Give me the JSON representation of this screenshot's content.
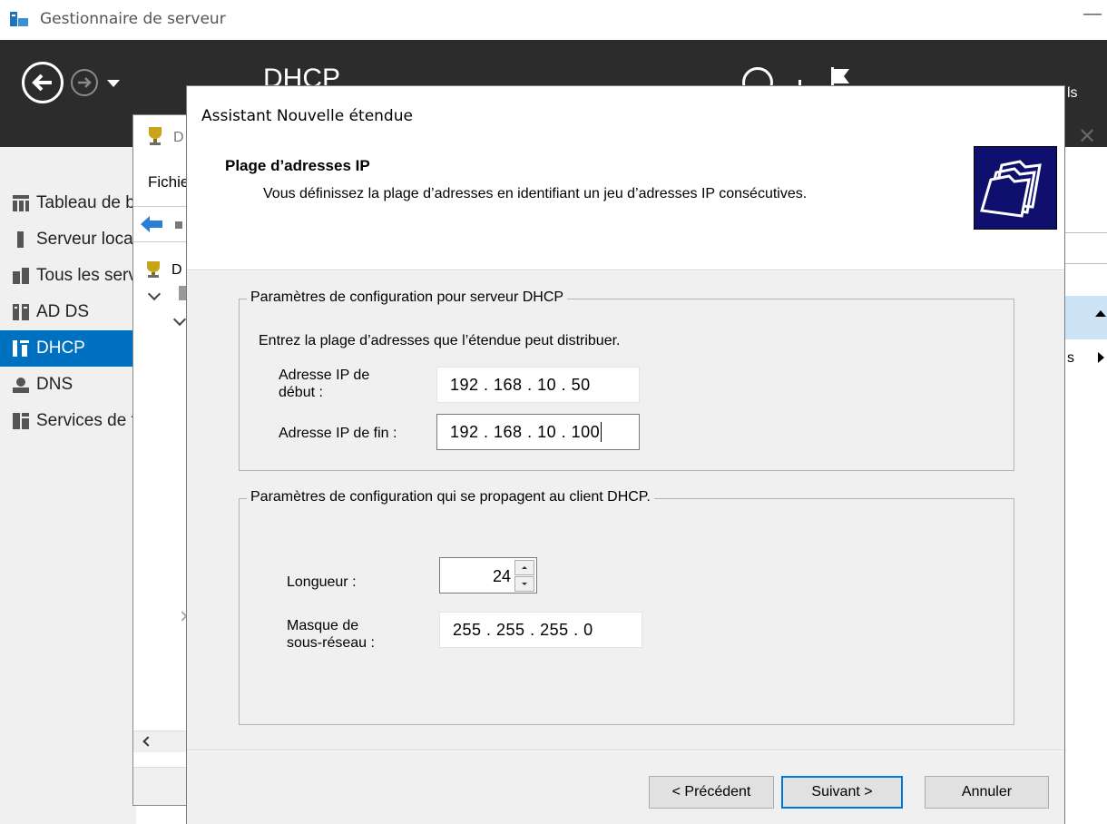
{
  "server_manager": {
    "title": "Gestionnaire de serveur",
    "breadcrumb": "DHCP",
    "tools_fragment": "ls",
    "sidebar": {
      "items": [
        {
          "label": "Tableau de bord",
          "icon": "dashboard-icon",
          "selected": false
        },
        {
          "label": "Serveur local",
          "icon": "server-icon",
          "selected": false
        },
        {
          "label": "Tous les serveurs",
          "icon": "servers-icon",
          "selected": false
        },
        {
          "label": "AD DS",
          "icon": "ad-ds-icon",
          "selected": false
        },
        {
          "label": "DHCP",
          "icon": "dhcp-icon",
          "selected": true
        },
        {
          "label": "DNS",
          "icon": "dns-icon",
          "selected": false
        },
        {
          "label": "Services de fichiers",
          "icon": "file-services-icon",
          "selected": false
        }
      ]
    },
    "right_panel_fragment": "s"
  },
  "dhcp_console": {
    "title_letter": "D",
    "menu_file": "Fichier",
    "tree_root_letter": "D"
  },
  "wizard": {
    "title": "Assistant Nouvelle étendue",
    "heading": "Plage d’adresses IP",
    "description": "Vous définissez la plage d’adresses en identifiant un jeu d’adresses IP consécutives.",
    "group_server": {
      "legend": "Paramètres de configuration pour serveur DHCP",
      "instruction": "Entrez la plage d’adresses que l’étendue peut distribuer.",
      "start_label_line1": "Adresse IP de",
      "start_label_line2": "début :",
      "start_ip": "192 . 168 .  10  .  50",
      "end_label": "Adresse IP de fin :",
      "end_ip": "192 . 168 .  10  . 100"
    },
    "group_client": {
      "legend": "Paramètres de configuration qui se propagent au client DHCP.",
      "length_label": "Longueur :",
      "length_value": "24",
      "mask_label_line1": "Masque de",
      "mask_label_line2": "sous-réseau :",
      "mask_value": "255 . 255 . 255 .  0"
    },
    "buttons": {
      "previous": "< Précédent",
      "next": "Suivant >",
      "cancel": "Annuler"
    }
  },
  "colors": {
    "accent": "#0070c0",
    "header_dark": "#2c2c2c",
    "dialog_bg": "#f0f0f0",
    "wizard_logo": "#0f0f6e"
  }
}
